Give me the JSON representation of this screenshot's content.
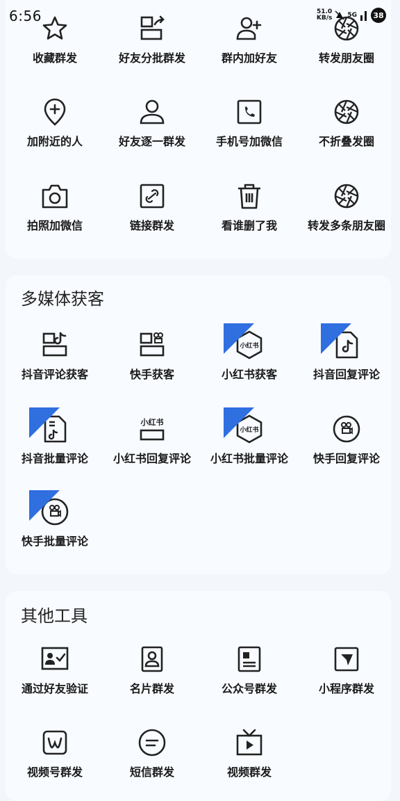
{
  "status_bar": {
    "time": "6:56",
    "net_speed_value": "51.0",
    "net_speed_unit": "KB/s",
    "network": "5G",
    "battery": "38"
  },
  "section_top": {
    "tools": [
      {
        "label": "收藏群发",
        "icon": "star-icon"
      },
      {
        "label": "好友分批群发",
        "icon": "batch-send-icon"
      },
      {
        "label": "群内加好友",
        "icon": "add-user-icon"
      },
      {
        "label": "转发朋友圈",
        "icon": "aperture-icon"
      },
      {
        "label": "加附近的人",
        "icon": "location-pin-plus-icon"
      },
      {
        "label": "好友逐一群发",
        "icon": "user-icon"
      },
      {
        "label": "手机号加微信",
        "icon": "phone-icon"
      },
      {
        "label": "不折叠发圈",
        "icon": "aperture-icon"
      },
      {
        "label": "拍照加微信",
        "icon": "camera-icon"
      },
      {
        "label": "链接群发",
        "icon": "link-icon"
      },
      {
        "label": "看谁删了我",
        "icon": "trash-icon"
      },
      {
        "label": "转发多条朋友圈",
        "icon": "aperture-icon"
      }
    ]
  },
  "section_media": {
    "title": "多媒体获客",
    "tools": [
      {
        "label": "抖音评论获客",
        "icon": "douyin-card-icon"
      },
      {
        "label": "快手获客",
        "icon": "kuaishou-card-icon"
      },
      {
        "label": "小红书获客",
        "icon": "xiaohongshu-hex-icon",
        "badge": true
      },
      {
        "label": "抖音回复评论",
        "icon": "douyin-doc-icon",
        "badge": true
      },
      {
        "label": "抖音批量评论",
        "icon": "douyin-list-doc-icon",
        "badge": true
      },
      {
        "label": "小红书回复评论",
        "icon": "xiaohongshu-card-icon"
      },
      {
        "label": "小红书批量评论",
        "icon": "xiaohongshu-hex-icon",
        "badge": true
      },
      {
        "label": "快手回复评论",
        "icon": "kuaishou-circle-icon"
      },
      {
        "label": "快手批量评论",
        "icon": "kuaishou-circle-icon",
        "badge": true
      }
    ],
    "xhs_logo_text": "小红书"
  },
  "section_other": {
    "title": "其他工具",
    "tools": [
      {
        "label": "通过好友验证",
        "icon": "verify-user-icon"
      },
      {
        "label": "名片群发",
        "icon": "contact-card-icon"
      },
      {
        "label": "公众号群发",
        "icon": "official-account-icon"
      },
      {
        "label": "小程序群发",
        "icon": "mini-program-icon"
      },
      {
        "label": "视频号群发",
        "icon": "channels-icon"
      },
      {
        "label": "短信群发",
        "icon": "sms-icon"
      },
      {
        "label": "视频群发",
        "icon": "tv-icon"
      }
    ]
  },
  "colors": {
    "accent": "#2f6fe0",
    "icon": "#222222",
    "card": "#f8fbff",
    "page": "#f3f6fb"
  }
}
